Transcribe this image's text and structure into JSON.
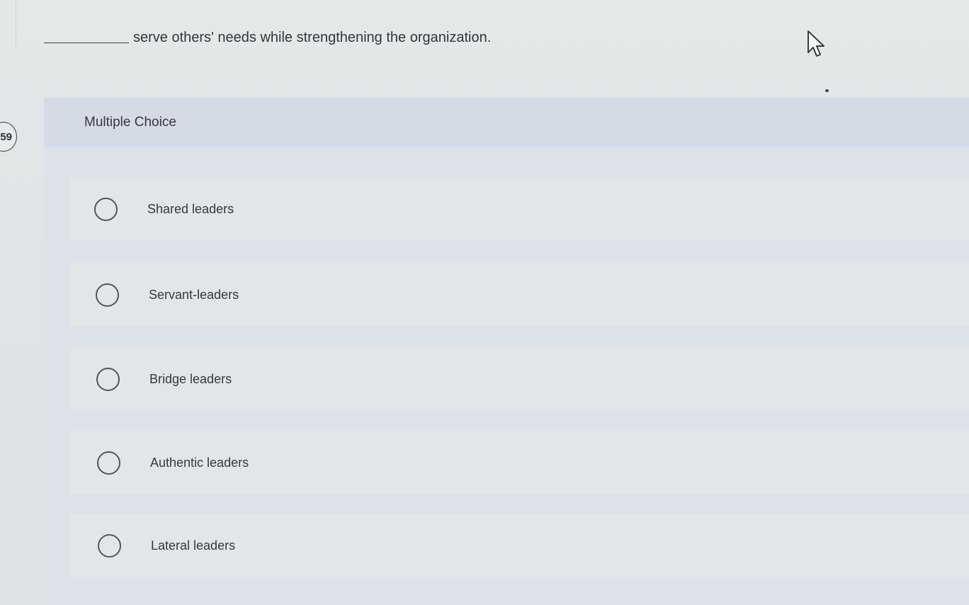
{
  "question": {
    "number": "59",
    "prompt_text": "serve others' needs while strengthening the organization.",
    "type_label": "Multiple Choice"
  },
  "options": [
    {
      "label": "Shared leaders"
    },
    {
      "label": "Servant-leaders"
    },
    {
      "label": "Bridge leaders"
    },
    {
      "label": "Authentic leaders"
    },
    {
      "label": "Lateral leaders"
    }
  ],
  "cursor": {
    "icon": "mouse-pointer-icon"
  },
  "colors": {
    "background": "#e4e8e9",
    "panel": "#dde2e8",
    "header_band": "#d5dbe6",
    "text": "#33373a"
  }
}
